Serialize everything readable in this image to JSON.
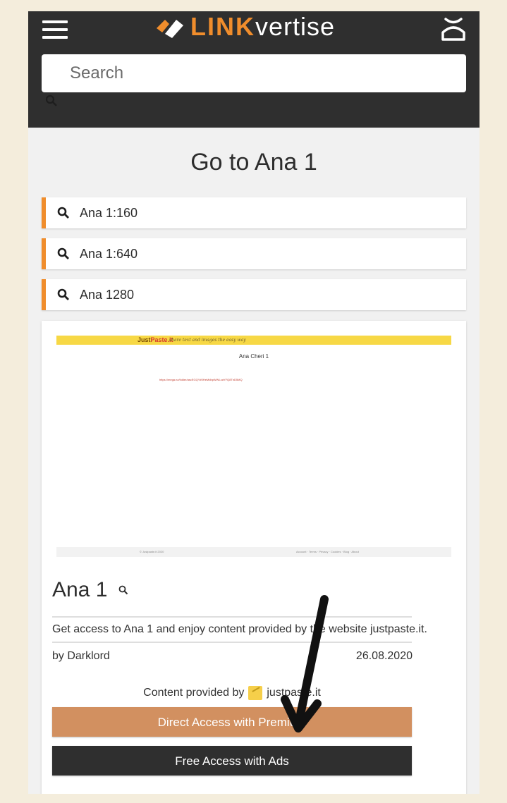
{
  "header": {
    "logo_bold": "LINK",
    "logo_light": "vertise",
    "search_placeholder": "Search"
  },
  "page_title": "Go to Ana 1",
  "results": [
    {
      "label": "Ana 1:160"
    },
    {
      "label": "Ana 1:640"
    },
    {
      "label": "Ana 1280"
    }
  ],
  "preview": {
    "site_name_a": "Just",
    "site_name_b": "Paste.it",
    "tagline": "share text and images the easy way",
    "title": "Ana Cheri 1",
    "link_text": "https://mega.nz/folder/ascEGQY#0HeMdbpWWLcaYFQ8TnD5MQ",
    "footer_left": "© Justpaste.it 2020",
    "footer_right": "Account · Terms · Privacy · Cookies · Blog · About"
  },
  "card": {
    "title": "Ana 1",
    "description": "Get access to Ana 1 and enjoy content provided by the website justpaste.it.",
    "author": "by Darklord",
    "date": "26.08.2020",
    "provided_prefix": "Content provided by",
    "provided_site": "justpaste.it",
    "premium_button": "Direct Access with Premium",
    "ads_button": "Free Access with Ads"
  },
  "colors": {
    "header_bg": "#2f2f2f",
    "accent": "#f08d2c",
    "premium_bg": "#d29060",
    "ads_bg": "#2f2f2f"
  }
}
